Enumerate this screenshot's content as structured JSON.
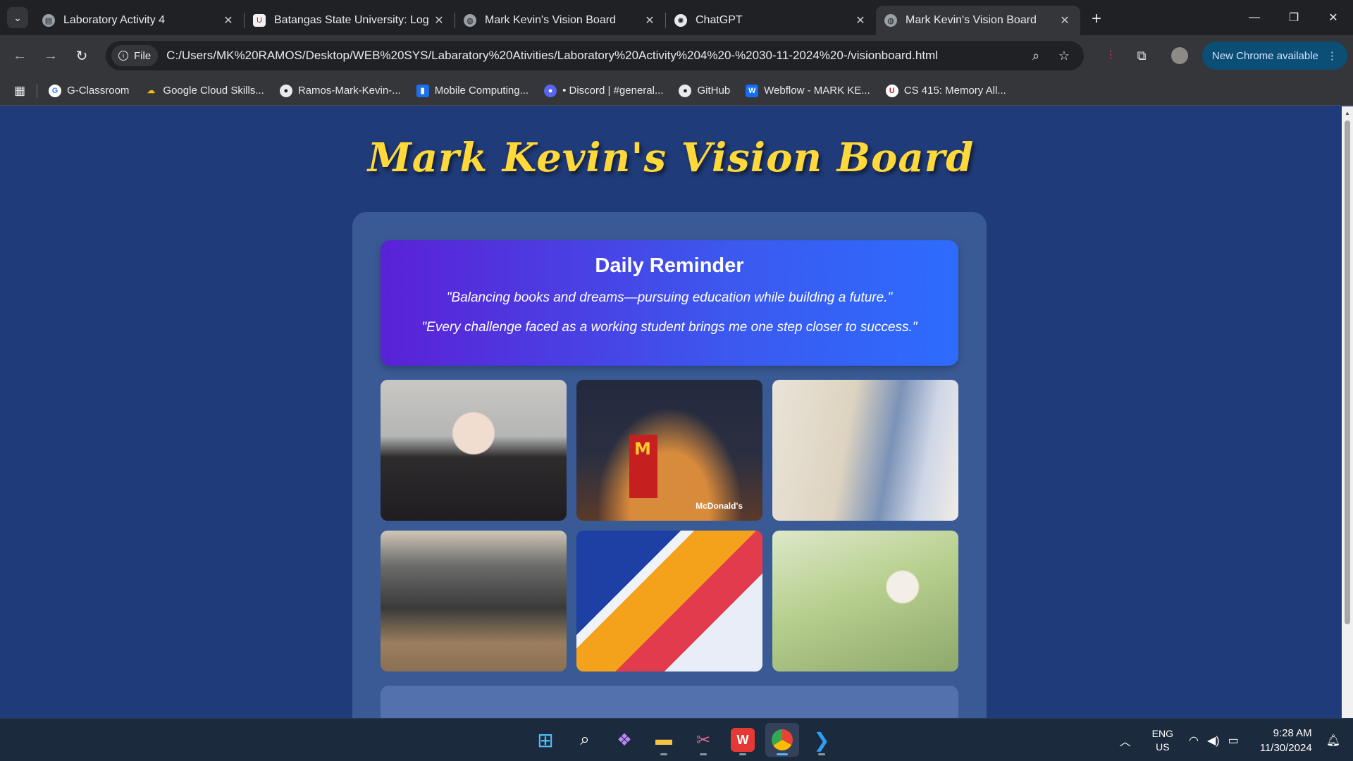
{
  "browser": {
    "tabs": [
      {
        "title": "Laboratory Activity 4",
        "icon": "document-icon"
      },
      {
        "title": "Batangas State University: Log i",
        "icon": "university-shield-icon"
      },
      {
        "title": "Mark Kevin's Vision Board",
        "icon": "globe-icon"
      },
      {
        "title": "ChatGPT",
        "icon": "chatgpt-icon"
      },
      {
        "title": "Mark Kevin's Vision Board",
        "icon": "globe-icon",
        "active": true
      }
    ],
    "chip_label": "File",
    "url": "C:/Users/MK%20RAMOS/Desktop/WEB%20SYS/Labaratory%20Ativities/Laboratory%20Activity%204%20-%2030-11-2024%20-/visionboard.html",
    "new_chrome_label": "New Chrome available",
    "bookmarks": [
      {
        "label": "G-Classroom",
        "color": "#4285f4",
        "glyph": "G"
      },
      {
        "label": "Google Cloud Skills...",
        "color": "#fbbc04",
        "glyph": "☁"
      },
      {
        "label": "Ramos-Mark-Kevin-...",
        "color": "#e8eaed",
        "glyph": "●"
      },
      {
        "label": "Mobile Computing...",
        "color": "#1f6feb",
        "glyph": "▮"
      },
      {
        "label": "• Discord | #general...",
        "color": "#5865f2",
        "glyph": "●"
      },
      {
        "label": "GitHub",
        "color": "#e8eaed",
        "glyph": "●"
      },
      {
        "label": "Webflow - MARK KE...",
        "color": "#146ef5",
        "glyph": "W"
      },
      {
        "label": "CS 415: Memory All...",
        "color": "#c62828",
        "glyph": "U"
      }
    ]
  },
  "page": {
    "title": "Mark Kevin's Vision Board",
    "reminder": {
      "heading": "Daily Reminder",
      "quote1": "\"Balancing books and dreams—pursuing education while building a future.\"",
      "quote2": "\"Every challenge faced as a working student brings me one step closer to success.\""
    },
    "colors": {
      "background": "#203b7a",
      "title": "#ffd83a",
      "board": "#3a5a95",
      "reminder_start": "#5b21d6",
      "reminder_end": "#2d6cff"
    },
    "mcdonalds_sign": "McDonald's"
  },
  "taskbar": {
    "language": "ENG",
    "region": "US",
    "time": "9:28 AM",
    "date": "11/30/2024"
  }
}
